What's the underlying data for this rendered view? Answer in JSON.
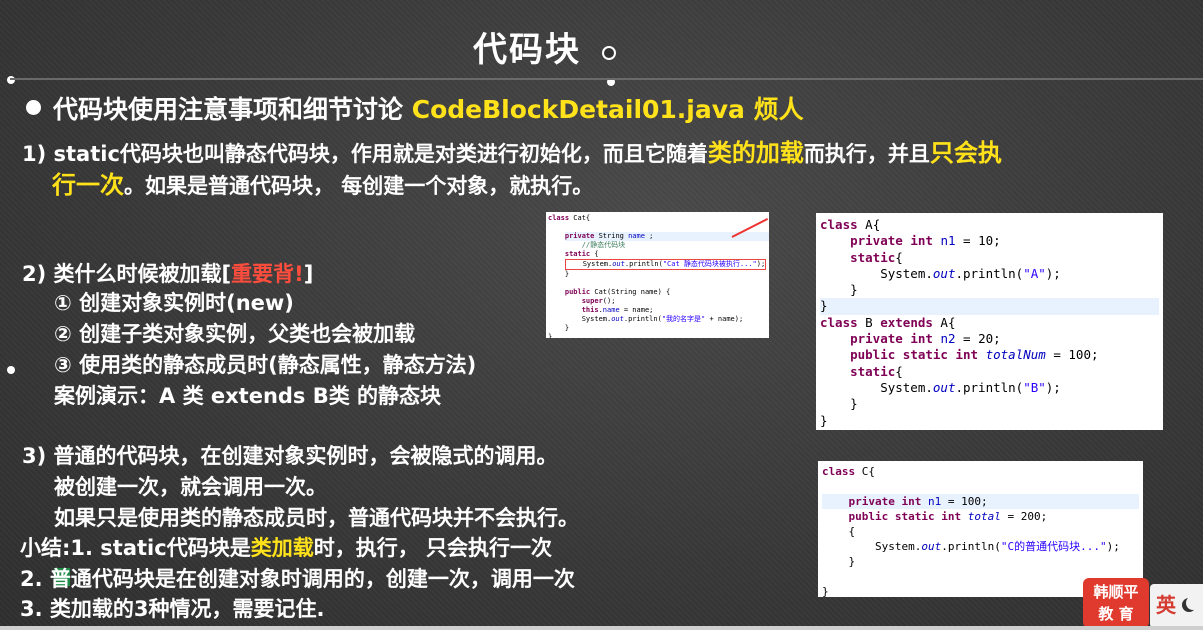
{
  "title": "代码块",
  "heading": {
    "prefix": "代码块使用注意事项和细节讨论",
    "file": "CodeBlockDetail01.java 烦人"
  },
  "p1": {
    "line1_a": "1) static代码块也叫静态代码块，作用就是对类进行初始化，而且它随着",
    "line1_hl1": "类的加载",
    "line1_b": "而执行，并且",
    "line1_hl2": "只会执",
    "line2_hl": "行一次",
    "line2_b": "。如果是普通代码块， 每创建一个对象，就执行。"
  },
  "p2": {
    "head_a": "2) 类什么时候被加载[",
    "head_red": "重要背!",
    "head_b": "]",
    "item1": "① 创建对象实例时(new)",
    "item2": "② 创建子类对象实例，父类也会被加载",
    "item3": "③ 使用类的静态成员时(静态属性，静态方法)",
    "demo": "案例演示：A 类 extends  B类 的静态块"
  },
  "p3": {
    "line1": "3) 普通的代码块，在创建对象实例时，会被隐式的调用。",
    "line2": "被创建一次，就会调用一次。",
    "line3": "如果只是使用类的静态成员时，普通代码块并不会执行。"
  },
  "summary": {
    "s1_a": "小结:1. static代码块是",
    "s1_hl": "类加载",
    "s1_b": "时，执行， 只会执行一次",
    "s2": "2. 普通代码块是在创建对象时调用的，创建一次，调用一次",
    "s3": "3. 类加载的3种情况，需要记住."
  },
  "code_cat": [
    "class Cat{",
    "",
    "    private String name ;",
    "    //静态代码块",
    "    static {",
    "        System.out.println(\"Cat 静态代码块被执行...\");",
    "    }",
    "",
    "    public Cat(String name) {",
    "        super();",
    "        this.name = name;",
    "        System.out.println(\"我的名字是\" + name);",
    "    }",
    "}"
  ],
  "code_ab": {
    "print_a": "\"A\"",
    "print_b": "\"B\""
  },
  "code_c": {
    "print_c": "\"C的普通代码块...\""
  },
  "logo": {
    "line1": "韩顺平",
    "line2": "教 育"
  },
  "ime": {
    "label": "英"
  },
  "colors": {
    "highlight": "#ffe21a",
    "red": "#ff4d3d",
    "background": "#3e3e3e"
  }
}
